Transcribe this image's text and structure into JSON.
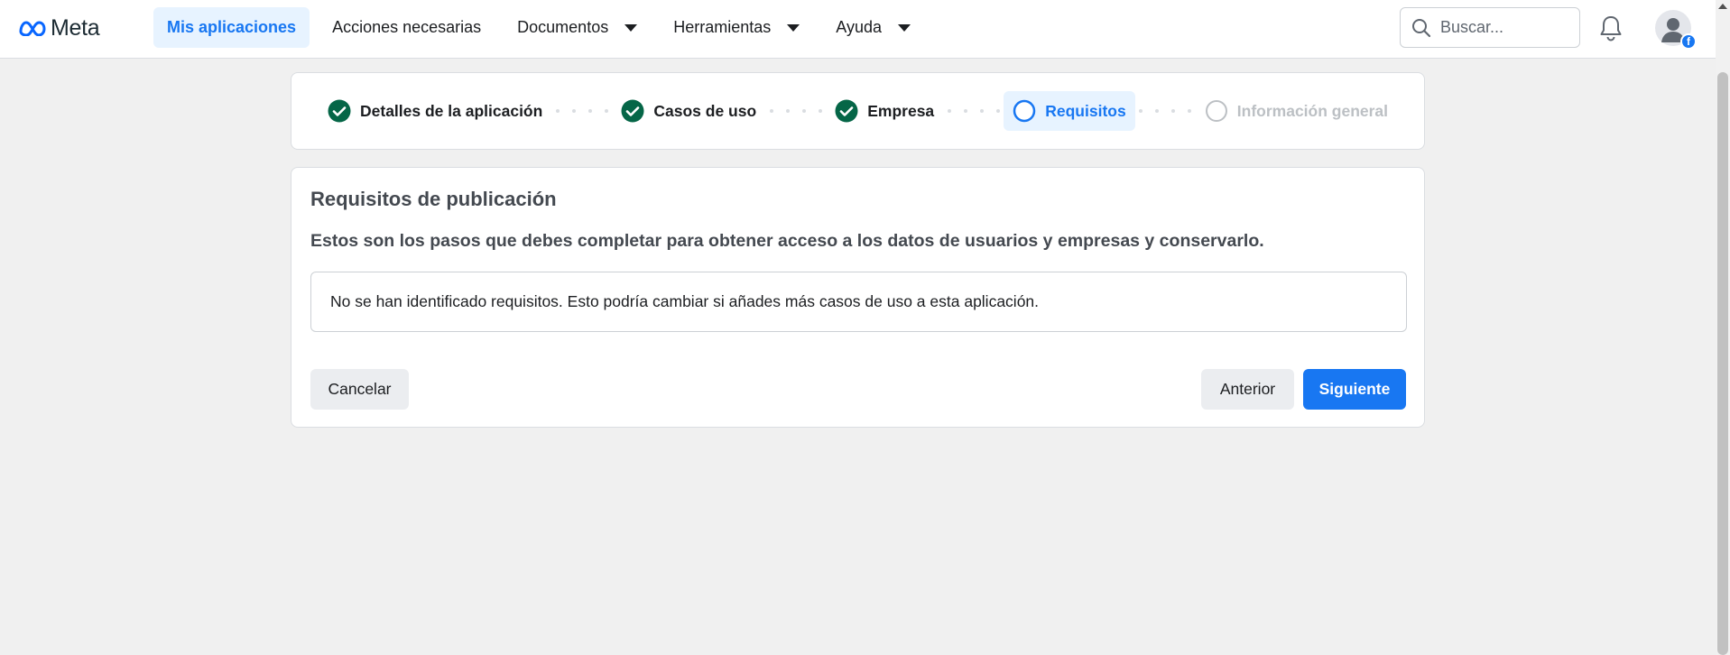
{
  "header": {
    "logo_text": "Meta",
    "nav": [
      {
        "label": "Mis aplicaciones",
        "active": true
      },
      {
        "label": "Acciones necesarias"
      },
      {
        "label": "Documentos",
        "dropdown": true
      },
      {
        "label": "Herramientas",
        "dropdown": true
      },
      {
        "label": "Ayuda",
        "dropdown": true
      }
    ],
    "search_placeholder": "Buscar...",
    "icons": [
      "search-icon",
      "bell-icon",
      "avatar",
      "facebook-badge-icon"
    ]
  },
  "stepper": {
    "steps": [
      {
        "label": "Detalles de la aplicación",
        "state": "done"
      },
      {
        "label": "Casos de uso",
        "state": "done"
      },
      {
        "label": "Empresa",
        "state": "done"
      },
      {
        "label": "Requisitos",
        "state": "current"
      },
      {
        "label": "Información general",
        "state": "pending"
      }
    ]
  },
  "card": {
    "title": "Requisitos de publicación",
    "subtitle": "Estos son los pasos que debes completar para obtener acceso a los datos de usuarios y empresas y conservarlo.",
    "notice": "No se han identificado requisitos. Esto podría cambiar si añades más casos de uso a esta aplicación.",
    "buttons": {
      "cancel": "Cancelar",
      "previous": "Anterior",
      "next": "Siguiente"
    }
  },
  "colors": {
    "brand_blue": "#1877f2",
    "done_green": "#056647",
    "page_bg": "#f0f0f0"
  }
}
